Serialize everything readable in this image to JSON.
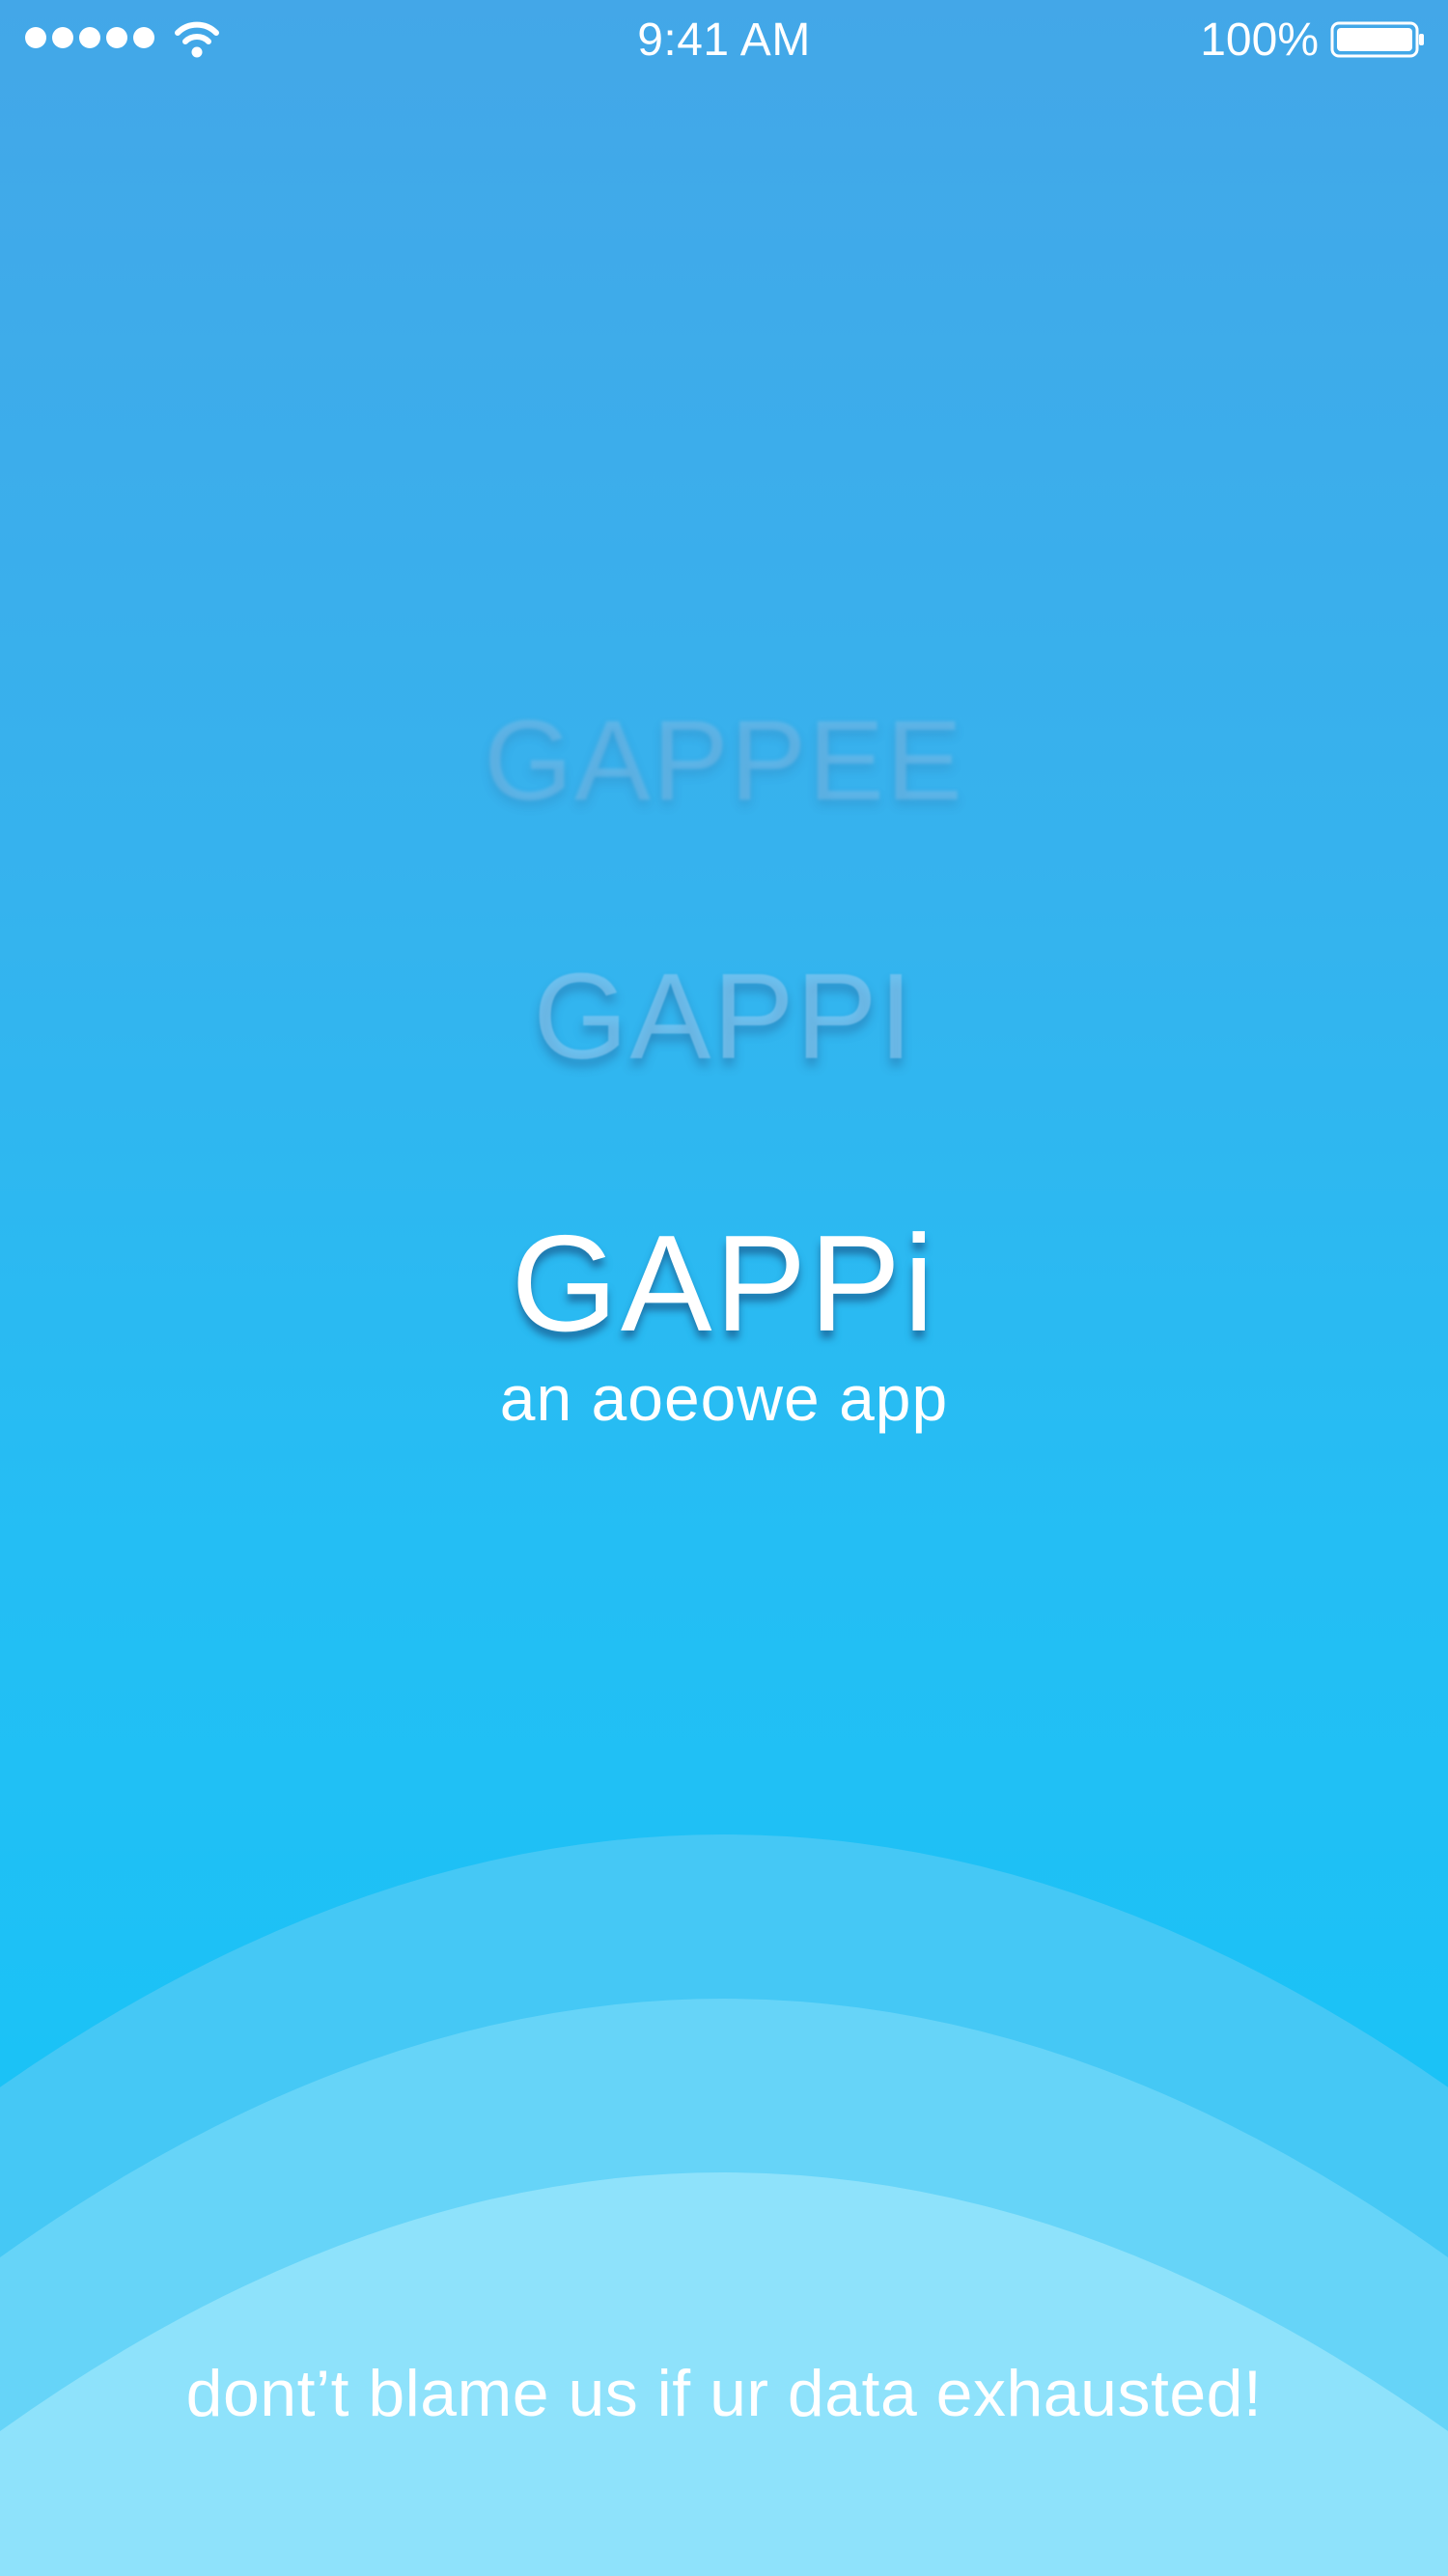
{
  "status_bar": {
    "time": "9:41 AM",
    "battery_percent": "100%",
    "signal_dots": 5,
    "battery_level": 1.0
  },
  "splash": {
    "ghost_title_1": "GAPPEE",
    "ghost_title_2": "GAPPI",
    "title": "GAPPi",
    "subtitle": "an aoeowe app",
    "footer": "dont’t blame us if ur data exhausted!"
  },
  "colors": {
    "background_top": "#43A7E8",
    "background_bottom": "#1BC2F6",
    "text": "#FFFFFF"
  },
  "icons": [
    "signal-icon",
    "wifi-icon",
    "battery-icon"
  ]
}
